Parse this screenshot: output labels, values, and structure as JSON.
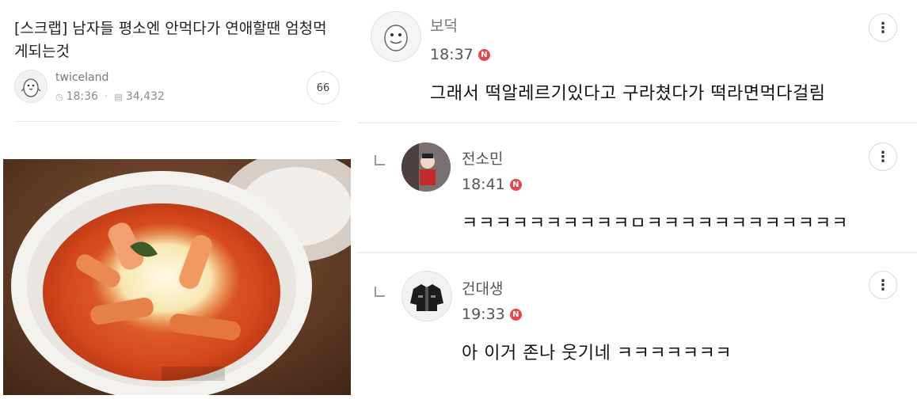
{
  "post": {
    "title": "[스크랩] 남자들 평소엔 안먹다가 연애할땐 엄청먹게되는것",
    "author": "twiceland",
    "time": "18:36",
    "views": "34,432",
    "comment_count": "66",
    "clock_icon": "clock-icon",
    "views_icon": "document-icon"
  },
  "comments": [
    {
      "name": "보덕",
      "time": "18:37",
      "badge": "N",
      "text": "그래서 떡알레르기있다고 구라쳤다가 떡라면먹다걸림",
      "is_reply": false
    },
    {
      "name": "전소민",
      "time": "18:41",
      "badge": "N",
      "text": "ㅋㅋㅋㅋㅋㅋㅋㅋㅋㅋㅁㅋㅋㅋㅋㅋㅋㅋㅋㅋㅋㅋㅋ",
      "is_reply": true
    },
    {
      "name": "건대생",
      "time": "19:33",
      "badge": "N",
      "text": "아 이거 존나 웃기네 ㅋㅋㅋㅋㅋㅋㅋ",
      "is_reply": true
    }
  ],
  "more_icon": "⋮",
  "colors": {
    "badge": "#e4484f",
    "divider": "#efefef"
  }
}
